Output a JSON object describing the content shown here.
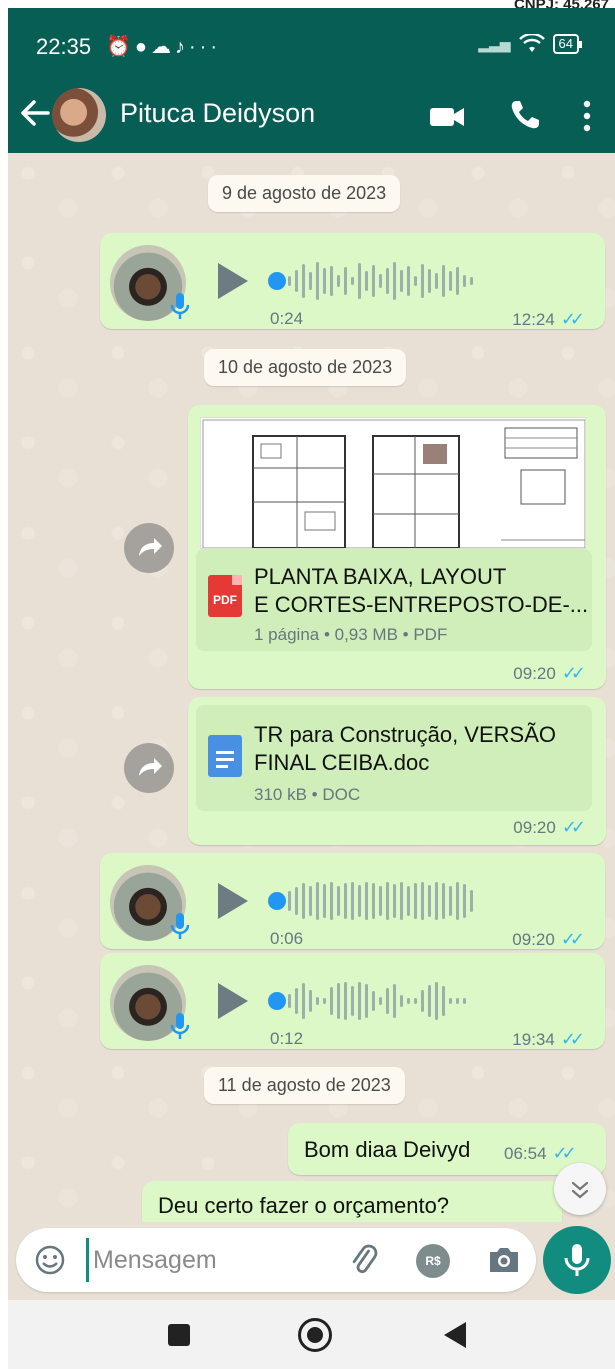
{
  "corner": {
    "text": "CNPJ: 45.267"
  },
  "status": {
    "time": "22:35",
    "battery": "64"
  },
  "header": {
    "contact_name": "Pituca Deidyson"
  },
  "dates": [
    "9 de agosto de 2023",
    "10 de agosto de 2023",
    "11 de agosto de 2023"
  ],
  "messages": [
    {
      "type": "voice",
      "duration": "0:24",
      "time": "12:24"
    },
    {
      "type": "pdf",
      "title_line1": "PLANTA BAIXA, LAYOUT",
      "title_line2": "E CORTES-ENTREPOSTO-DE-...",
      "meta": "1 página • 0,93 MB • PDF",
      "icon_label": "PDF",
      "time": "09:20"
    },
    {
      "type": "doc",
      "title_line1": "TR para Construção, VERSÃO",
      "title_line2": "FINAL CEIBA.doc",
      "meta": "310 kB • DOC",
      "time": "09:20"
    },
    {
      "type": "voice",
      "duration": "0:06",
      "time": "09:20"
    },
    {
      "type": "voice",
      "duration": "0:12",
      "time": "19:34"
    },
    {
      "type": "text",
      "text": "Bom diaa Deivyd",
      "time": "06:54"
    },
    {
      "type": "text_in",
      "text": "Deu certo fazer o orçamento?"
    }
  ],
  "input": {
    "placeholder": "Mensagem",
    "pay_label": "R$"
  },
  "colors": {
    "header": "#075e54",
    "outgoing": "#dcf8c6",
    "accent": "#128c7e",
    "ticks": "#34b7f1"
  }
}
